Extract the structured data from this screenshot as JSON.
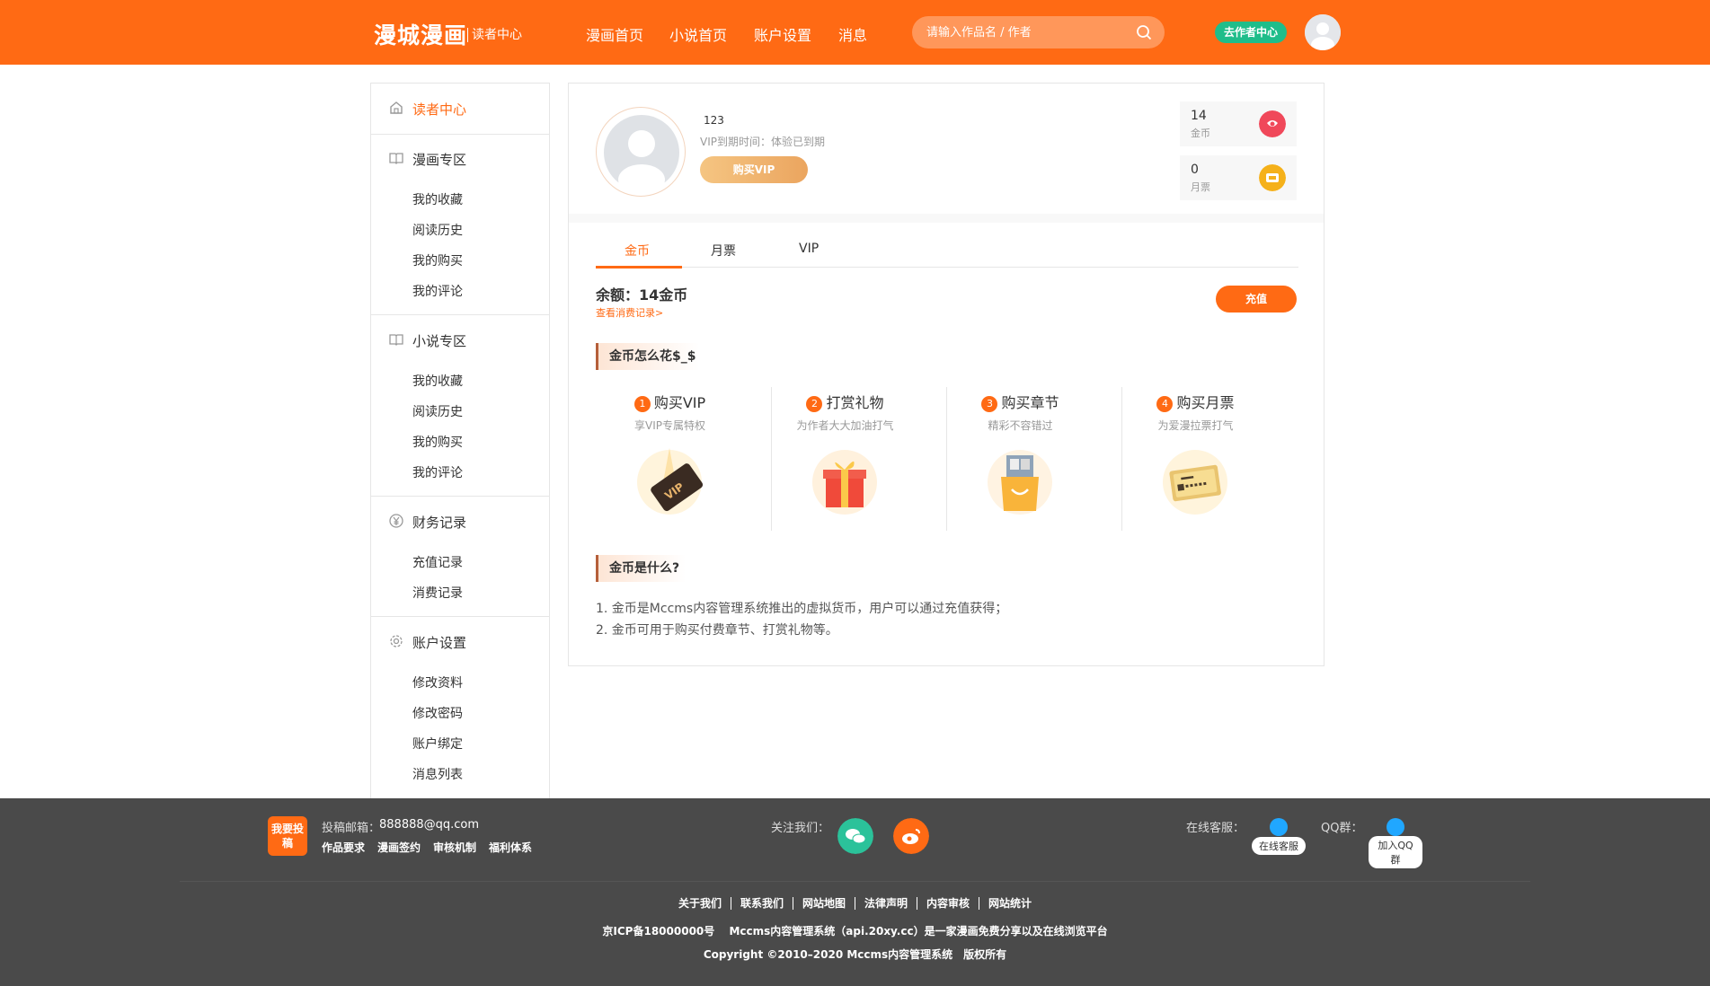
{
  "header": {
    "logo": "漫城漫画",
    "logo_sub": "读者中心",
    "nav": [
      "漫画首页",
      "小说首页",
      "账户设置",
      "消息"
    ],
    "search_placeholder": "请输入作品名 / 作者",
    "author_center": "去作者中心"
  },
  "sidebar": {
    "home": "读者中心",
    "comic_title": "漫画专区",
    "comic_items": [
      "我的收藏",
      "阅读历史",
      "我的购买",
      "我的评论"
    ],
    "novel_title": "小说专区",
    "novel_items": [
      "我的收藏",
      "阅读历史",
      "我的购买",
      "我的评论"
    ],
    "finance_title": "财务记录",
    "finance_items": [
      "充值记录",
      "消费记录"
    ],
    "account_title": "账户设置",
    "account_items": [
      "修改资料",
      "修改密码",
      "账户绑定",
      "消息列表"
    ]
  },
  "profile": {
    "username": "123",
    "vip_line": "VIP到期时间：体验已到期",
    "buy_vip": "购买VIP",
    "coins": {
      "value": "14",
      "label": "金币"
    },
    "tickets": {
      "value": "0",
      "label": "月票"
    }
  },
  "tabs": [
    "金币",
    "月票",
    "VIP"
  ],
  "balance": "余额：14金币",
  "records_link": "查看消费记录>",
  "charge_button": "充值",
  "how_title": "金币怎么花$_$",
  "features": [
    {
      "num": "1",
      "title": "购买VIP",
      "desc": "享VIP专属特权"
    },
    {
      "num": "2",
      "title": "打赏礼物",
      "desc": "为作者大大加油打气"
    },
    {
      "num": "3",
      "title": "购买章节",
      "desc": "精彩不容错过"
    },
    {
      "num": "4",
      "title": "购买月票",
      "desc": "为爱漫拉票打气"
    }
  ],
  "what_title": "金币是什么?",
  "what_lines": [
    "1. 金币是Mccms内容管理系统推出的虚拟货币，用户可以通过充值获得；",
    "2. 金币可用于购买付费章节、打赏礼物等。"
  ],
  "footer": {
    "tougao": "我要投稿",
    "email_label": "投稿邮箱：",
    "email": "888888@qq.com",
    "sub_links": [
      "作品要求",
      "漫画签约",
      "审核机制",
      "福利体系"
    ],
    "follow": "关注我们：",
    "service_label": "在线客服：",
    "service_btn": "在线客服",
    "qq_label": "QQ群：",
    "qq_btn": "加入QQ群",
    "links": [
      "关于我们",
      "联系我们",
      "网站地图",
      "法律声明",
      "内容审核",
      "网站统计"
    ],
    "icp": "京ICP备18000000号　 Mccms内容管理系统（api.20xy.cc）是一家漫画免费分享以及在线浏览平台",
    "copyright": "Copyright ©2010–2020 Mccms内容管理系统　版权所有"
  },
  "colors": {
    "accent": "#ff6a14",
    "author_btn": "#1fbd8a",
    "footer_bg": "#4a4a4a"
  }
}
